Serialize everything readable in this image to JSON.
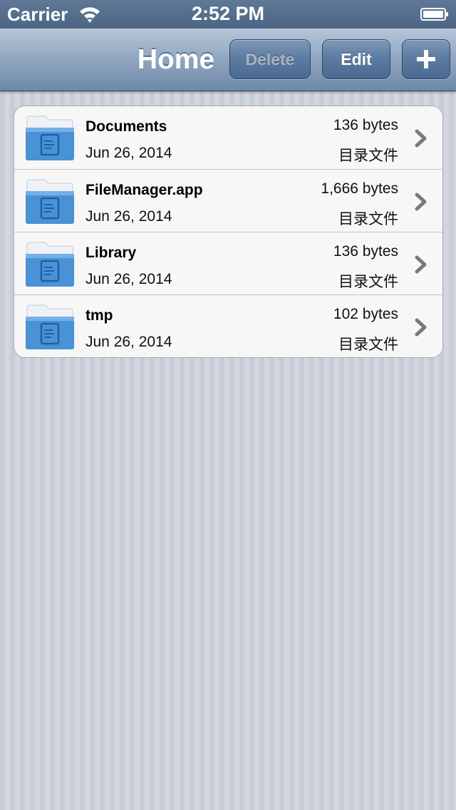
{
  "status_bar": {
    "carrier": "Carrier",
    "time": "2:52 PM",
    "wifi_icon": "wifi-icon",
    "battery_icon": "battery-icon"
  },
  "nav_bar": {
    "title": "Home",
    "delete_label": "Delete",
    "edit_label": "Edit",
    "add_icon": "plus-icon"
  },
  "files": [
    {
      "name": "Documents",
      "date": "Jun 26, 2014",
      "size": "136 bytes",
      "kind": "目录文件",
      "icon": "folder-icon"
    },
    {
      "name": "FileManager.app",
      "date": "Jun 26, 2014",
      "size": "1,666 bytes",
      "kind": "目录文件",
      "icon": "folder-icon"
    },
    {
      "name": "Library",
      "date": "Jun 26, 2014",
      "size": "136 bytes",
      "kind": "目录文件",
      "icon": "folder-icon"
    },
    {
      "name": "tmp",
      "date": "Jun 26, 2014",
      "size": "102 bytes",
      "kind": "目录文件",
      "icon": "folder-icon"
    }
  ],
  "colors": {
    "nav_tint": "#5b7aa0",
    "background": "#cbd0da",
    "folder_blue": "#4a92d6"
  }
}
